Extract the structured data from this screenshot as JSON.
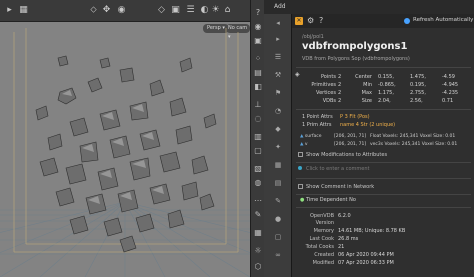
{
  "viewport": {
    "toolbar_labels": {
      "view_btn": "Persp ▾",
      "cam_btn": "No cam ▾"
    }
  },
  "net_tabs": [
    {
      "label": "Add"
    }
  ],
  "popup": {
    "refresh_label": "Refresh Automatically",
    "node_path": "/obj/pol1",
    "node_name": "vdbfrompolygons1",
    "node_type": "VDB from Polygons Sop (vdbfrompolygons)",
    "geo_counts": [
      {
        "label": "Points",
        "value": "2"
      },
      {
        "label": "Primitives",
        "value": "2"
      },
      {
        "label": "Vertices",
        "value": "2"
      },
      {
        "label": "VDBs",
        "value": "2"
      }
    ],
    "bbox": [
      {
        "label": "Center",
        "values": [
          "0.155,",
          "1.475,",
          "-4.59"
        ]
      },
      {
        "label": "Min",
        "values": [
          "-0.865,",
          "0.195,",
          "-4.945"
        ]
      },
      {
        "label": "Max",
        "values": [
          "1.175,",
          "2.755,",
          "-4.235"
        ]
      },
      {
        "label": "Size",
        "values": [
          "2.04,",
          "2.56,",
          "0.71"
        ]
      }
    ],
    "point_attr": {
      "label": "1 Point Attrs",
      "value": "P 3 Flt (Pos)"
    },
    "prim_attr": {
      "label": "1 Prim Attrs",
      "value": "name 4 Str (2 unique)"
    },
    "vdb_rows": [
      {
        "name": "surface",
        "res": "[206, 201, 71]",
        "detail": "Float  Voxels: 245,341  Voxel Size: 0.01"
      },
      {
        "name": "v",
        "res": "[206, 201, 71]",
        "detail": "vec3s  Voxels: 245,341  Voxel Size: 0.01"
      }
    ],
    "show_mods": "Show Modifications to Attributes",
    "comment_placeholder": "Click to enter a comment",
    "show_comment": "Show Comment in Network",
    "time_dependent": {
      "label": "Time Dependent",
      "value": "No"
    },
    "info": [
      {
        "label": "OpenVDB",
        "value": "6.2.0"
      },
      {
        "label": "Version",
        "value": ""
      },
      {
        "label": "Memory",
        "value": "14.61 MB; Unique: 8.78 KB"
      },
      {
        "label": "Last Cook",
        "value": "26.8 ms"
      },
      {
        "label": "Total Cooks",
        "value": "21"
      },
      {
        "label": "Created",
        "value": "06 Apr 2020 09:44 PM"
      },
      {
        "label": "Modified",
        "value": "07 Apr 2020 06:33 PM"
      }
    ],
    "accent_colors": {
      "pin": "#e8a12a",
      "time_dep": "#8fe07f",
      "attr_highlight": "#f0b04a",
      "vdb_bullet": "#5a9fd6"
    }
  }
}
